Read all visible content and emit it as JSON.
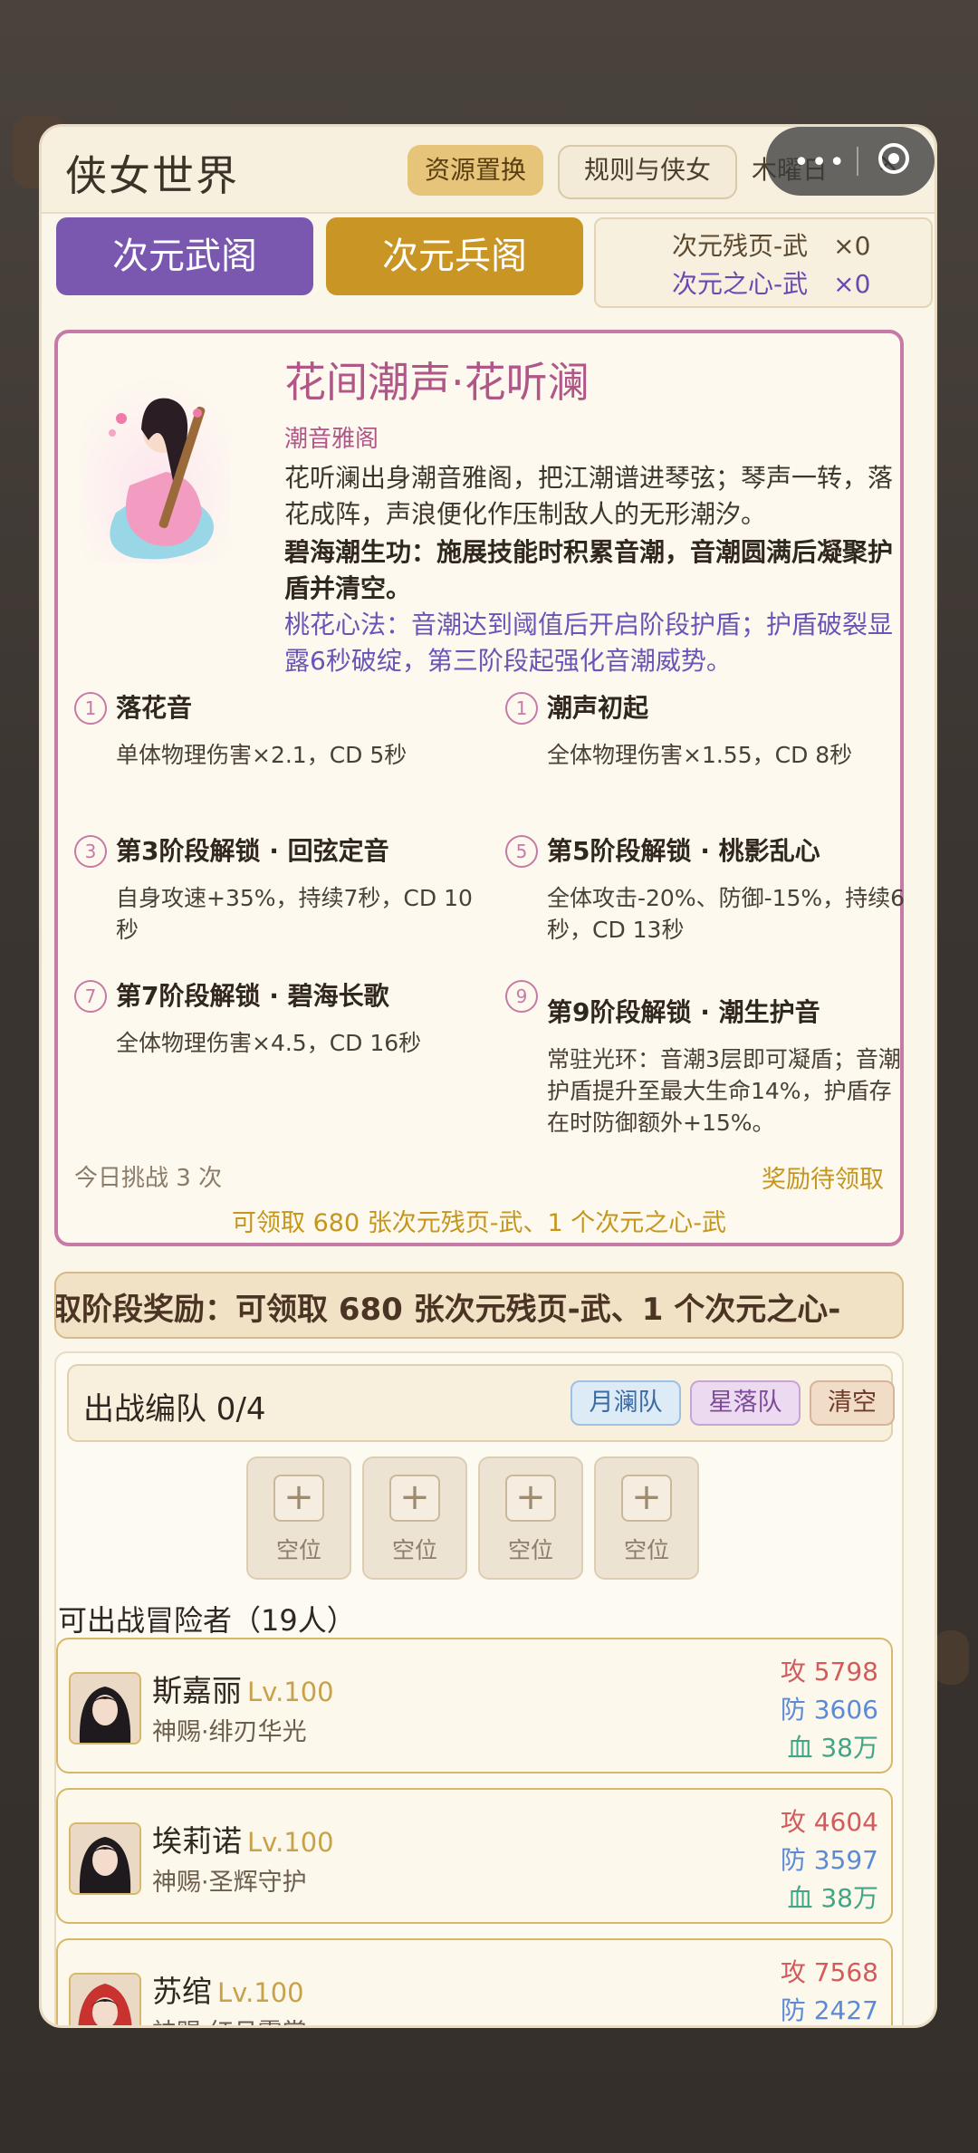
{
  "header": {
    "title": "侠女世界",
    "resource_swap": "资源置换",
    "rules": "规则与侠女",
    "day": "木曜日",
    "close": "×"
  },
  "tabs": {
    "wu": "次元武阁",
    "bing": "次元兵阁"
  },
  "inventory": {
    "pages": "次元残页-武　×0",
    "hearts": "次元之心-武　×0"
  },
  "hero": {
    "name": "花间潮声·花听澜",
    "faction": "潮音雅阁",
    "description": "花听澜出身潮音雅阁，把江潮谱进琴弦；琴声一转，落花成阵，声浪便化作压制敌人的无形潮汐。",
    "skill_a": "碧海潮生功：施展技能时积累音潮，音潮圆满后凝聚护盾并清空。",
    "skill_b": "桃花心法：音潮达到阈值后开启阶段护盾；护盾破裂显露6秒破绽，第三阶段起强化音潮威势。",
    "skills": [
      {
        "num": "1",
        "name": "落花音",
        "effect": "单体物理伤害×2.1，CD 5秒"
      },
      {
        "num": "1",
        "name": "潮声初起",
        "effect": "全体物理伤害×1.55，CD 8秒"
      },
      {
        "num": "3",
        "name": "第3阶段解锁 · 回弦定音",
        "effect": "自身攻速+35%，持续7秒，CD 10秒"
      },
      {
        "num": "5",
        "name": "第5阶段解锁 · 桃影乱心",
        "effect": "全体攻击-20%、防御-15%，持续6秒，CD 13秒"
      },
      {
        "num": "7",
        "name": "第7阶段解锁 · 碧海长歌",
        "effect": "全体物理伤害×4.5，CD 16秒"
      },
      {
        "num": "9",
        "name": "第9阶段解锁 · 潮生护音",
        "effect": "常驻光环：音潮3层即可凝盾；音潮护盾提升至最大生命14%，护盾存在时防御额外+15%。"
      }
    ],
    "challenge": "今日挑战 3 次",
    "reward_status": "奖励待领取",
    "reward_detail": "可领取 680 张次元残页-武、1 个次元之心-武"
  },
  "banner": "取阶段奖励：可领取 680 张次元残页-武、1 个次元之心-",
  "formation": {
    "title": "出战编队  0/4",
    "presets": {
      "moon": "月澜队",
      "star": "星落队",
      "clear": "清空"
    },
    "slot_label": "空位"
  },
  "available_title": "可出战冒险者（19人）",
  "adventurers": [
    {
      "name": "斯嘉丽",
      "level": "Lv.100",
      "title": "神赐·绯刃华光",
      "atk": "攻 5798",
      "def": "防 3606",
      "hp": "血 38万"
    },
    {
      "name": "埃莉诺",
      "level": "Lv.100",
      "title": "神赐·圣辉守护",
      "atk": "攻 4604",
      "def": "防 3597",
      "hp": "血 38万"
    },
    {
      "name": "苏绾",
      "level": "Lv.100",
      "title": "神赐·红月霓裳",
      "atk": "攻 7568",
      "def": "防 2427",
      "hp": ""
    }
  ]
}
